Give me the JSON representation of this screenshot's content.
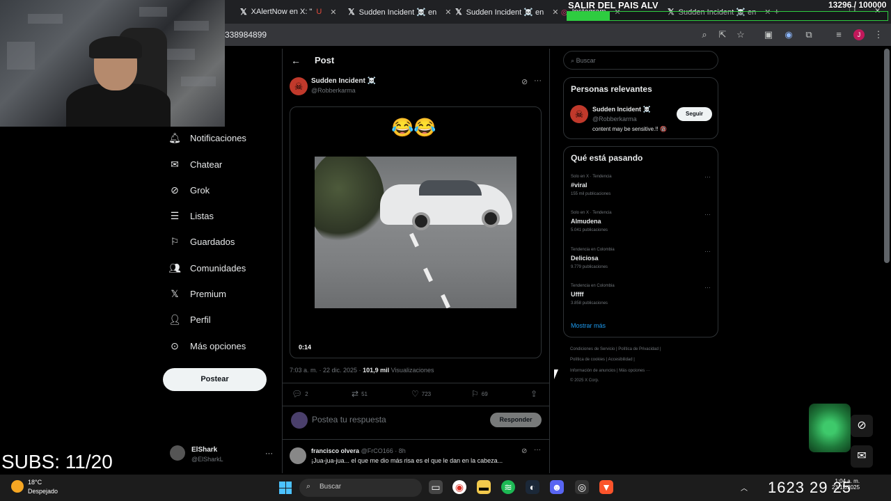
{
  "browser": {
    "tabs": [
      {
        "label": "XAlertNow en X: \"",
        "suffix": "U"
      },
      {
        "label": "Sudden Incident ☠️ en"
      },
      {
        "label": "Sudden Incident ☠️ en"
      },
      {
        "label": "Instagram"
      },
      {
        "label": "Sudden Incident ☠️ en"
      }
    ],
    "url_fragment": "338984899",
    "profile_initial": "J"
  },
  "stream": {
    "title": "SALIR DEL PAIS ALV",
    "goal_text": "13296  / 100000",
    "goal_fraction": 0.133,
    "subs": "SUBS: 11/20"
  },
  "sidebar": {
    "items": [
      {
        "label": "Notificaciones",
        "icon": "bell-icon"
      },
      {
        "label": "Chatear",
        "icon": "mail-icon"
      },
      {
        "label": "Grok",
        "icon": "grok-icon"
      },
      {
        "label": "Listas",
        "icon": "list-icon"
      },
      {
        "label": "Guardados",
        "icon": "bookmark-icon"
      },
      {
        "label": "Comunidades",
        "icon": "people-icon"
      },
      {
        "label": "Premium",
        "icon": "x-logo-icon"
      },
      {
        "label": "Perfil",
        "icon": "person-icon"
      },
      {
        "label": "Más opciones",
        "icon": "more-circle-icon"
      }
    ],
    "post_button": "Postear",
    "account": {
      "name": "ElShark",
      "handle": "@ElSharkL"
    }
  },
  "post": {
    "header": "Post",
    "author_name": "Sudden Incident ☠️",
    "author_handle": "@Robberkarma",
    "text": "😂😂",
    "duration": "0:14",
    "timestamp": "7:03 a. m. · 22 dic. 2025 · ",
    "views_number": "101,9 mil",
    "views_label": " Visualizaciones",
    "stats": {
      "replies": "2",
      "reposts": "51",
      "likes": "723",
      "bookmarks": "69"
    },
    "reply_placeholder": "Postea tu respuesta",
    "reply_button": "Responder"
  },
  "comment": {
    "name": "francisco olvera",
    "handle": "@FrCO166 · 8h",
    "text": "¡Jua-jua-jua... el que me dio más risa es el que le dan en la cabeza..."
  },
  "right": {
    "search_placeholder": "Buscar",
    "relevant_title": "Personas relevantes",
    "relevant": {
      "name": "Sudden Incident ☠️",
      "handle": "@Robberkarma",
      "bio": "content may be sensitive.!! 🔞",
      "follow": "Seguir"
    },
    "trends_title": "Qué está pasando",
    "trends": [
      {
        "context": "Solo en X · Tendencia",
        "name": "#viral",
        "count": "155 mil publicaciones"
      },
      {
        "context": "Solo en X · Tendencia",
        "name": "Almudena",
        "count": "5.041 publicaciones"
      },
      {
        "context": "Tendencia en Colombia",
        "name": "Deliciosa",
        "count": "9.779 publicaciones"
      },
      {
        "context": "Tendencia en Colombia",
        "name": "Uffff",
        "count": "3.858 publicaciones"
      }
    ],
    "show_more": "Mostrar más",
    "footer": [
      "Condiciones de Servicio  |  Política de Privacidad  |",
      "Política de cookies  |  Accesibilidad  |",
      "Información de anuncios  |  Más opciones ···",
      "© 2025 X Corp."
    ]
  },
  "taskbar": {
    "weather_temp": "18°C",
    "weather_desc": "Despejado",
    "search_label": "Buscar",
    "clock_overlay": "1623 29 25",
    "time": "1:04 a. m.",
    "date": "23/12/2025"
  }
}
